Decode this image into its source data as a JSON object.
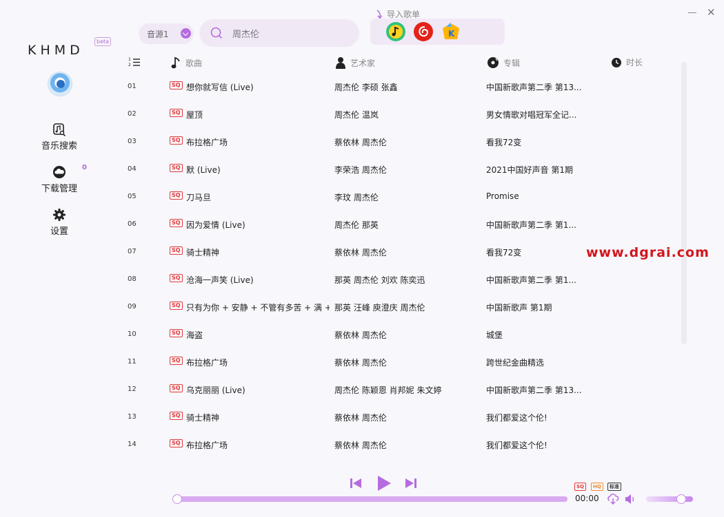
{
  "window": {
    "close_glyph": "✕"
  },
  "sidebar": {
    "logo": "KHMD",
    "beta": "beta",
    "nav": [
      {
        "label": "音乐搜索",
        "icon": "music-search-icon"
      },
      {
        "label": "下载管理",
        "icon": "download-cloud-icon",
        "badge": "0"
      },
      {
        "label": "设置",
        "icon": "gear-icon"
      }
    ]
  },
  "header": {
    "source": "音源1",
    "search_value": "周杰伦",
    "import_label": "导入歌单",
    "import_apps": [
      "qq-music-icon",
      "netease-music-icon",
      "kugou-music-icon"
    ]
  },
  "table": {
    "columns": {
      "title": "歌曲",
      "artist": "艺术家",
      "album": "专辑",
      "duration": "时长"
    },
    "quality_tag": "SQ",
    "rows": [
      {
        "num": "01",
        "title": "想你就写信 (Live)",
        "artist": "周杰伦 李硕 张鑫",
        "album": "中国新歌声第二季 第13..."
      },
      {
        "num": "02",
        "title": "屋顶",
        "artist": "周杰伦 温岚",
        "album": "男女情歌对唱冠军全记..."
      },
      {
        "num": "03",
        "title": "布拉格广场",
        "artist": "蔡依林 周杰伦",
        "album": "看我72变"
      },
      {
        "num": "04",
        "title": "默 (Live)",
        "artist": "李荣浩 周杰伦",
        "album": "2021中国好声音 第1期"
      },
      {
        "num": "05",
        "title": "刀马旦",
        "artist": "李玟 周杰伦",
        "album": "Promise"
      },
      {
        "num": "06",
        "title": "因为爱情 (Live)",
        "artist": "周杰伦 那英",
        "album": "中国新歌声第二季 第1..."
      },
      {
        "num": "07",
        "title": "骑士精神",
        "artist": "蔡依林 周杰伦",
        "album": "看我72变"
      },
      {
        "num": "08",
        "title": "沧海一声笑 (Live)",
        "artist": "那英 周杰伦 刘欢 陈奕迅",
        "album": "中国新歌声第二季 第1..."
      },
      {
        "num": "09",
        "title": "只有为你 + 安静 + 不管有多苦 + 满 +",
        "artist": "那英 汪峰 庾澄庆 周杰伦",
        "album": "中国新歌声 第1期"
      },
      {
        "num": "10",
        "title": "海盗",
        "artist": "蔡依林 周杰伦",
        "album": "城堡"
      },
      {
        "num": "11",
        "title": "布拉格广场",
        "artist": "蔡依林 周杰伦",
        "album": "跨世纪金曲精选"
      },
      {
        "num": "12",
        "title": "乌克丽丽 (Live)",
        "artist": "周杰伦 陈颖恩 肖邦妮 朱文婷",
        "album": "中国新歌声第二季 第13..."
      },
      {
        "num": "13",
        "title": "骑士精神",
        "artist": "蔡依林 周杰伦",
        "album": "我们都爱这个伦!"
      },
      {
        "num": "14",
        "title": "布拉格广场",
        "artist": "蔡依林 周杰伦",
        "album": "我们都爱这个伦!"
      }
    ]
  },
  "player": {
    "time": "00:00",
    "progress": 0,
    "volume": 0.75,
    "quality_badges": [
      "SQ",
      "HQ",
      "标准"
    ],
    "accent": "#b66be0"
  },
  "watermark": "www.dgrai.com"
}
